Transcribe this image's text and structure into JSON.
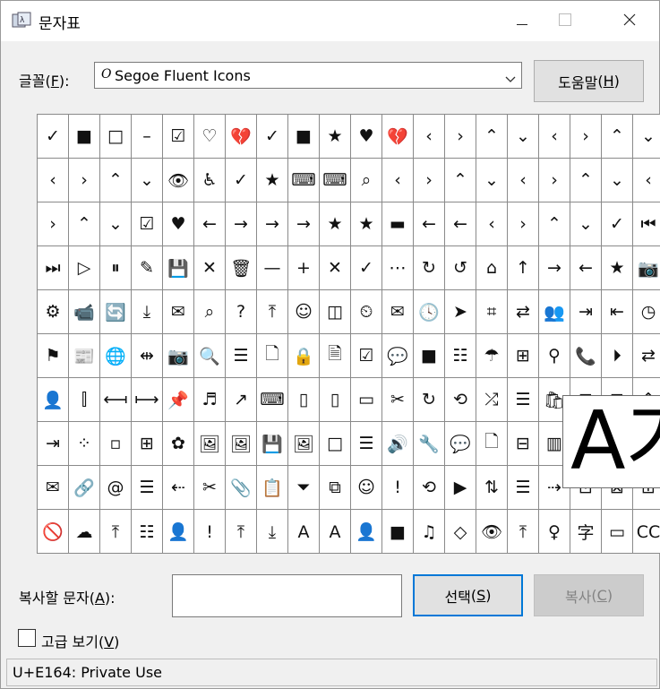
{
  "window": {
    "title": "문자표"
  },
  "font": {
    "label_text": "글꼴",
    "label_accel_open": "(",
    "label_accel_key": "F",
    "label_accel_close": "):",
    "selected_font": "Segoe Fluent Icons",
    "font_type_glyph": "O"
  },
  "help_button": {
    "label": "도움말",
    "accel_open": "(",
    "accel_key": "H",
    "accel_close": ")"
  },
  "grid": {
    "rows": [
      [
        "✓",
        "■",
        "□",
        "–",
        "☑",
        "♡",
        "💔",
        "✓",
        "■",
        "★",
        "♥",
        "💔",
        "‹",
        "›",
        "⌃",
        "⌄",
        "‹",
        "›",
        "⌃",
        "⌄"
      ],
      [
        "‹",
        "›",
        "⌃",
        "⌄",
        "👁",
        "♿",
        "✓",
        "★",
        "⌨",
        "⌨",
        "⌕",
        "‹",
        "›",
        "⌃",
        "⌄",
        "‹",
        "›",
        "⌃",
        "⌄",
        "‹"
      ],
      [
        "›",
        "⌃",
        "⌄",
        "☑",
        "♥",
        "←",
        "→",
        "→",
        "→",
        "★",
        "★",
        "▬",
        "←",
        "←",
        "‹",
        "›",
        "⌃",
        "⌄",
        "✓",
        "⏮"
      ],
      [
        "⏭",
        "▷",
        "⏸",
        "✎",
        "💾",
        "✕",
        "🗑",
        "—",
        "+",
        "✕",
        "✓",
        "⋯",
        "↻",
        "↺",
        "⌂",
        "↑",
        "→",
        "←",
        "★",
        "📷"
      ],
      [
        "⚙",
        "📹",
        "🔄",
        "⤓",
        "✉",
        "⌕",
        "?",
        "⤒",
        "☺",
        "◫",
        "⏲",
        "✉",
        "🕓",
        "➤",
        "⌗",
        "⇄",
        "👥",
        "⇥",
        "⇤",
        "◷"
      ],
      [
        "⚑",
        "📰",
        "🌐",
        "⇹",
        "📷",
        "🔍",
        "☰",
        "🗋",
        "🔒",
        "🗎",
        "☑",
        "💬",
        "■",
        "☷",
        "☂",
        "⊞",
        "⚲",
        "📞",
        "⏵",
        "⇄"
      ],
      [
        "👤",
        "⫿",
        "⟻",
        "⟼",
        "📌",
        "♬",
        "↗",
        "⌨",
        "▯",
        "▯",
        "▭",
        "✂",
        "↻",
        "⟲",
        "⤮",
        "☰",
        "🛍",
        "⊞",
        "⊡",
        "⌃"
      ],
      [
        "⇥",
        "⁘",
        "▫",
        "⊞",
        "✿",
        "🖼",
        "🖼",
        "💾",
        "🖼",
        "□",
        "☰",
        "🔊",
        "🔧",
        "💬",
        "🗋",
        "⊟",
        "▥",
        "✕",
        "⊡",
        "⌃"
      ],
      [
        "✉",
        "🔗",
        "@",
        "☰",
        "⇠",
        "✂",
        "📎",
        "📋",
        "⏷",
        "⧉",
        "☺",
        "!",
        "⟲",
        "▶",
        "⇅",
        "☰",
        "⇢",
        "⊡",
        "⊠",
        "⊞"
      ],
      [
        "🚫",
        "☁",
        "⤒",
        "☷",
        "👤",
        "!",
        "⤒",
        "⤓",
        "A",
        "A",
        "👤",
        "■",
        "♫",
        "◇",
        "👁",
        "⤒",
        "♀",
        "字",
        "▭",
        "CC"
      ]
    ]
  },
  "magnifier": {
    "glyph": "A가"
  },
  "copy": {
    "label_text": "복사할 문자",
    "accel_open": "(",
    "accel_key": "A",
    "accel_close": "):",
    "input_value": ""
  },
  "select_button": {
    "label": "선택",
    "accel_open": "(",
    "accel_key": "S",
    "accel_close": ")"
  },
  "copy_button": {
    "label": "복사",
    "accel_open": "(",
    "accel_key": "C",
    "accel_close": ")"
  },
  "advanced": {
    "label_text": "고급 보기",
    "accel_open": "(",
    "accel_key": "V",
    "accel_close": ")",
    "checked": false
  },
  "status": {
    "text": "U+E164: Private Use"
  }
}
